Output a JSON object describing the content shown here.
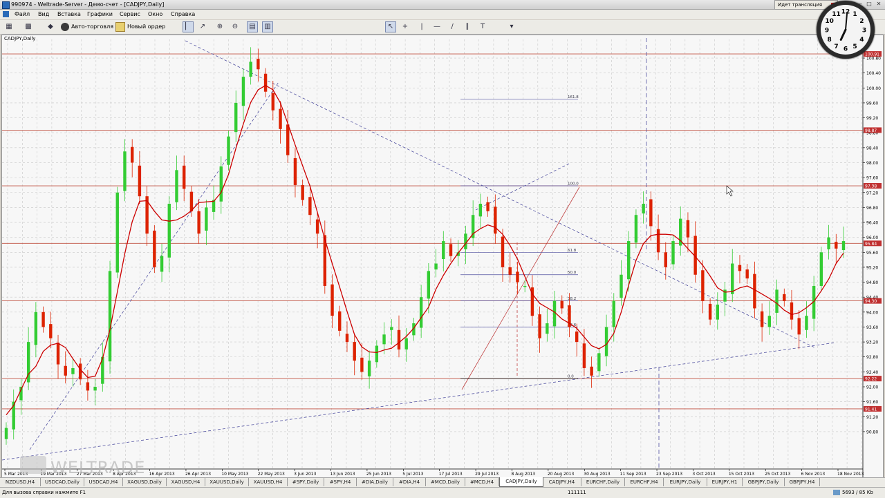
{
  "window": {
    "title": "990974 - Weltrade-Server - Демо-счет - [CADJPY,Daily]",
    "broadcast": "Идет трансляция"
  },
  "menu": [
    "Файл",
    "Вид",
    "Вставка",
    "Графики",
    "Сервис",
    "Окно",
    "Справка"
  ],
  "toolbar": {
    "autotrade": "Авто-торговля",
    "new_order": "Новый ордер"
  },
  "chart": {
    "symbol_label": "CADJPY,Daily",
    "watermark": "WELTRADE",
    "x_dates": [
      "5 Mar 2013",
      "19 Mar 2013",
      "27 Mar 2013",
      "8 Apr 2013",
      "16 Apr 2013",
      "26 Apr 2013",
      "10 May 2013",
      "22 May 2013",
      "3 Jun 2013",
      "13 Jun 2013",
      "25 Jun 2013",
      "5 Jul 2013",
      "17 Jul 2013",
      "29 Jul 2013",
      "8 Aug 2013",
      "20 Aug 2013",
      "30 Aug 2013",
      "11 Sep 2013",
      "23 Sep 2013",
      "3 Oct 2013",
      "15 Oct 2013",
      "25 Oct 2013",
      "6 Nov 2013",
      "18 Nov 2013"
    ],
    "price_ticks": [
      "100.80",
      "100.00",
      "99.20",
      "98.40",
      "98.00",
      "97.20",
      "96.40",
      "96.00",
      "95.60",
      "95.20",
      "94.80",
      "94.40",
      "93.60",
      "93.20",
      "92.80",
      "92.40",
      "92.00",
      "91.60",
      "91.20",
      "90.80"
    ],
    "price_ticks_all": [
      "100.80",
      "100.40",
      "100.00",
      "99.60",
      "99.20",
      "98.80",
      "98.40",
      "98.00",
      "97.60",
      "97.20",
      "96.80",
      "96.40",
      "96.00",
      "95.60",
      "95.20",
      "94.80",
      "94.40",
      "94.00",
      "93.60",
      "93.20",
      "92.80",
      "92.40",
      "92.00",
      "91.60",
      "91.20",
      "90.80"
    ],
    "level_labels": [
      "100.91",
      "98.87",
      "97.38",
      "95.84",
      "94.30",
      "92.22",
      "91.41"
    ],
    "fib_labels": [
      "161.8",
      "100.0",
      "61.8",
      "50.0",
      "38.2",
      "23.6",
      "0.0"
    ],
    "up_color": "#33cc33",
    "down_color": "#dd2200",
    "ma_color": "#cc0000",
    "level_color": "#c05040"
  },
  "chart_data": {
    "type": "candlestick",
    "title": "CADJPY,Daily",
    "ylim": [
      89.8,
      101.3
    ],
    "horizontal_levels": [
      100.91,
      98.87,
      97.38,
      95.84,
      94.3,
      92.22,
      91.41
    ],
    "fibonacci": {
      "0.0": 92.22,
      "23.6": 93.6,
      "38.2": 94.3,
      "50.0": 95.0,
      "61.8": 95.6,
      "100.0": 97.38,
      "161.8": 99.7
    },
    "close_approx": [
      90.9,
      91.6,
      92.0,
      93.2,
      94.0,
      93.6,
      93.3,
      92.6,
      92.3,
      92.5,
      92.2,
      91.9,
      92.0,
      92.8,
      95.1,
      97.2,
      98.3,
      98.0,
      97.1,
      96.1,
      95.2,
      95.5,
      96.9,
      97.8,
      97.3,
      96.7,
      96.1,
      96.8,
      97.0,
      97.9,
      98.7,
      99.6,
      100.3,
      100.7,
      100.5,
      99.9,
      99.4,
      98.9,
      98.2,
      97.4,
      97.0,
      96.6,
      96.1,
      94.7,
      93.9,
      93.5,
      93.2,
      92.7,
      92.4,
      92.7,
      93.1,
      93.4,
      93.6,
      93.0,
      93.3,
      93.7,
      94.4,
      95.1,
      95.3,
      95.9,
      95.5,
      95.6,
      96.1,
      96.6,
      96.9,
      96.7,
      96.1,
      95.2,
      95.0,
      94.8,
      94.7,
      93.9,
      93.3,
      93.7,
      94.3,
      94.1,
      93.6,
      93.2,
      92.5,
      92.3,
      92.9,
      93.6,
      94.3,
      95.0,
      95.9,
      96.6,
      96.9,
      96.3,
      95.6,
      95.2,
      95.9,
      96.5,
      96.0,
      95.0,
      94.3,
      93.8,
      94.2,
      94.6,
      95.3,
      95.1,
      94.9,
      94.1,
      93.6,
      93.9,
      94.6,
      94.3,
      93.8,
      93.4,
      93.9,
      94.7,
      95.6,
      96.0,
      95.7,
      95.9
    ],
    "moving_average": "red line"
  },
  "tabs": [
    "NZDUSD,H4",
    "USDCAD,Daily",
    "USDCAD,H4",
    "XAGUSD,Daily",
    "XAGUSD,H4",
    "XAUUSD,Daily",
    "XAUUSD,H4",
    "#SPY,Daily",
    "#SPY,H4",
    "#DIA,Daily",
    "#DIA,H4",
    "#MCD,Daily",
    "#MCD,H4",
    "CADJPY,Daily",
    "CADJPY,H4",
    "EURCHF,Daily",
    "EURCHF,H4",
    "EURJPY,Daily",
    "EURJPY,H1",
    "GBPJPY,Daily",
    "GBPJPY,H4"
  ],
  "active_tab": "CADJPY,Daily",
  "status": {
    "help": "Для вызова справки нажмите F1",
    "profile": "111111",
    "traffic": "5693 / 85 Kb"
  },
  "clock": {
    "numbers": [
      "12",
      "1",
      "2",
      "3",
      "4",
      "5",
      "6",
      "7",
      "8",
      "9",
      "10",
      "11"
    ]
  }
}
